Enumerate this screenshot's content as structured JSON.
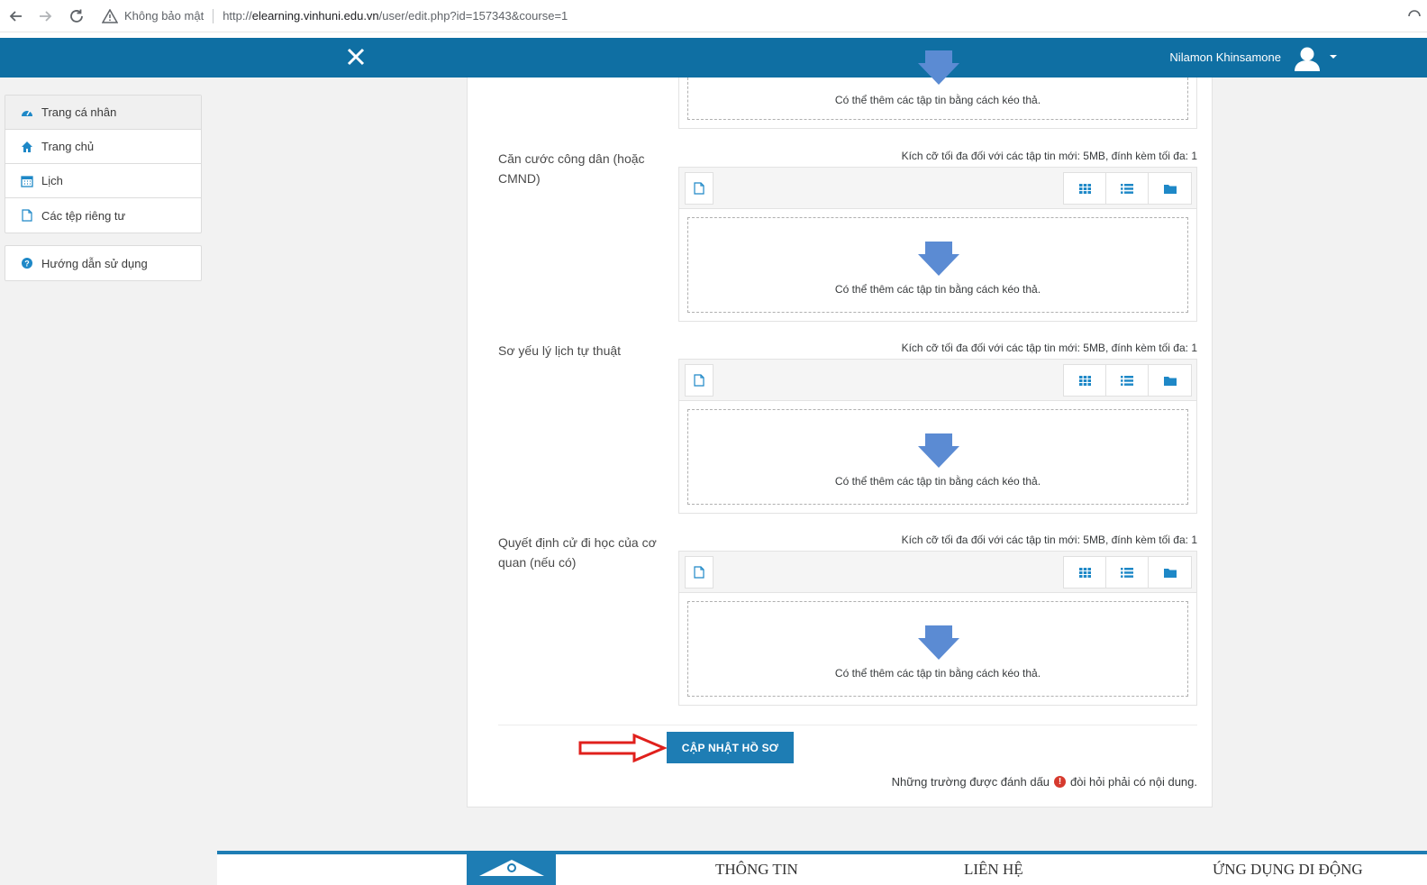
{
  "browser": {
    "security_label": "Không bảo mật",
    "url_prefix": "http://",
    "url_host": "elearning.vinhuni.edu.vn",
    "url_path": "/user/edit.php?id=157343&course=1"
  },
  "navbar": {
    "user_name": "Nilamon Khinsamone"
  },
  "sidebar": {
    "items": [
      {
        "label": "Trang cá nhân",
        "icon": "dashboard-icon"
      },
      {
        "label": "Trang chủ",
        "icon": "home-icon"
      },
      {
        "label": "Lịch",
        "icon": "calendar-icon"
      },
      {
        "label": "Các tệp riêng tư",
        "icon": "file-icon"
      }
    ],
    "help": {
      "label": "Hướng dẫn sử dụng",
      "icon": "help-icon"
    }
  },
  "form": {
    "drop_text": "Có thể thêm các tập tin bằng cách kéo thả.",
    "max_note": "Kích cỡ tối đa đối với các tập tin mới: 5MB, đính kèm tối đa: 1",
    "fields": [
      {
        "label": "Căn cước công dân (hoặc CMND)"
      },
      {
        "label": "Sơ yếu lý lịch tự thuật"
      },
      {
        "label": "Quyết định cử đi học của cơ quan (nếu có)"
      }
    ],
    "submit_label": "CẬP NHẬT HỒ SƠ",
    "required_prefix": "Những trường được đánh dấu",
    "required_suffix": "đòi hỏi phải có nội dung."
  },
  "footer": {
    "links": [
      "THÔNG TIN",
      "LIÊN HỆ",
      "ỨNG DỤNG DI ĐỘNG"
    ]
  },
  "colors": {
    "navbar": "#0f6fa3",
    "accent": "#1e7db4",
    "required": "#d63a2e"
  }
}
